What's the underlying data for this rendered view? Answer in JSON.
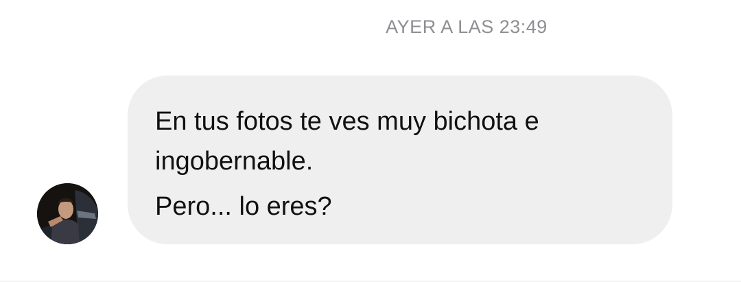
{
  "timestamp": "AYER A LAS 23:49",
  "message": {
    "lines": [
      "En tus fotos te ves muy bichota e",
      "ingobernable.",
      "Pero... lo eres?"
    ],
    "bubble_color": "#efefef",
    "text_color": "#111111"
  },
  "avatar": {
    "icon": "profile-photo"
  },
  "colors": {
    "timestamp": "#8e8e93",
    "background": "#ffffff"
  }
}
